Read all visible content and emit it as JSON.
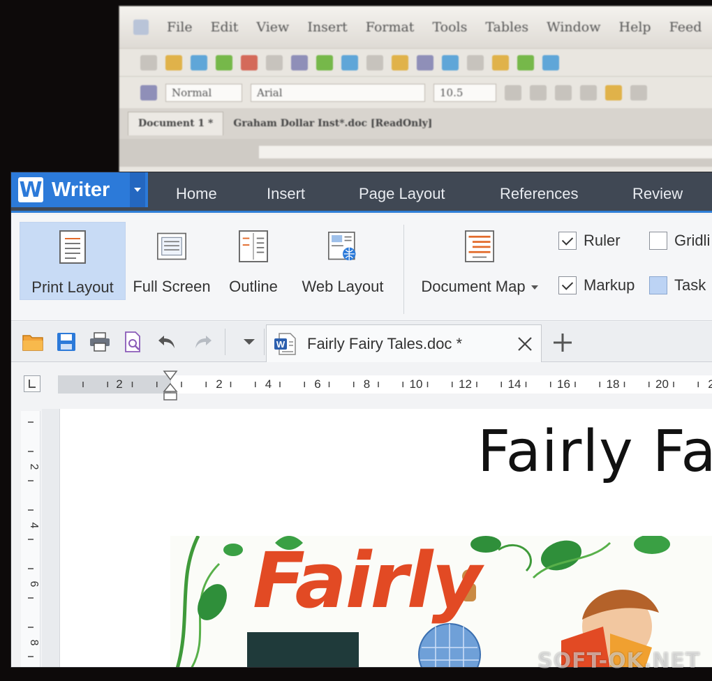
{
  "app": {
    "name": "Writer",
    "logo_letter": "W"
  },
  "ribbon_tabs": [
    "Home",
    "Insert",
    "Page Layout",
    "References",
    "Review"
  ],
  "view_buttons": [
    {
      "label": "Print Layout",
      "active": true
    },
    {
      "label": "Full Screen",
      "active": false
    },
    {
      "label": "Outline",
      "active": false
    },
    {
      "label": "Web Layout",
      "active": false
    },
    {
      "label": "Document Map",
      "active": false
    }
  ],
  "checkboxes": [
    {
      "label": "Ruler",
      "checked": true
    },
    {
      "label": "Gridli",
      "checked": false
    },
    {
      "label": "Markup",
      "checked": true
    },
    {
      "label": "Task",
      "checked": false
    }
  ],
  "document_tab": {
    "title": "Fairly Fairy Tales.doc *"
  },
  "ruler": {
    "h_labels": [
      "2",
      "2",
      "4",
      "6",
      "8",
      "10",
      "12",
      "14",
      "16",
      "18",
      "20",
      "2"
    ],
    "v_labels": [
      "2",
      "4",
      "6",
      "8"
    ]
  },
  "document": {
    "heading": "Fairly Fai",
    "cover_title": "Fairly"
  },
  "watermark": "SOFT-OK.NET",
  "background_window": {
    "menu": [
      "File",
      "Edit",
      "View",
      "Insert",
      "Format",
      "Tools",
      "Tables",
      "Window",
      "Help",
      "Feed"
    ],
    "style_combo": "Normal",
    "font_combo": "Arial",
    "size_combo": "10.5",
    "doc_tab": "Document 1 *",
    "doc_tab_2": "Graham Dollar Inst*.doc [ReadOnly]"
  },
  "colors": {
    "accent": "#2c7ad9",
    "titlebar": "#404854",
    "active_button": "#c8dbf5"
  }
}
